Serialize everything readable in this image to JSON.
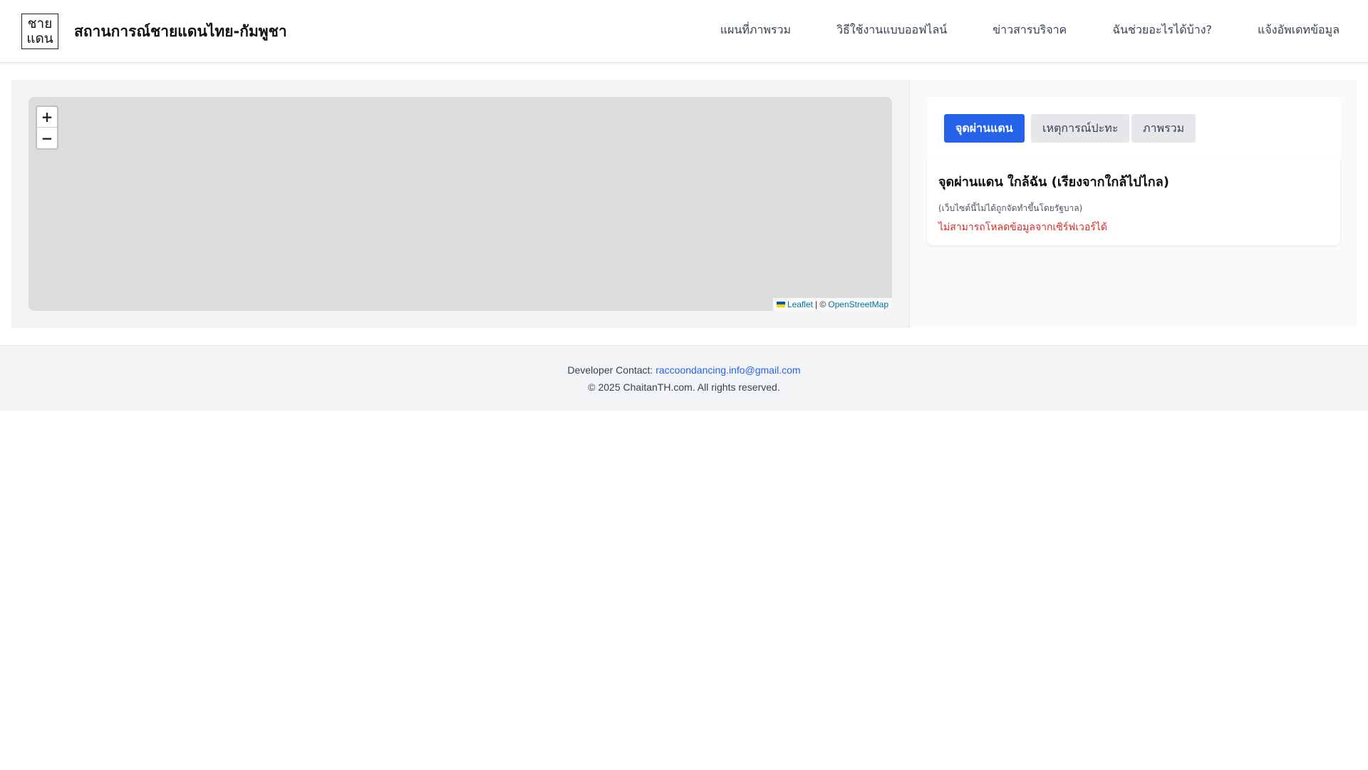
{
  "header": {
    "logo_line1": "ชาย",
    "logo_line2": "แดน",
    "title": "สถานการณ์ชายแดนไทย-กัมพูชา",
    "nav": [
      "แผนที่ภาพรวม",
      "วิธีใช้งานแบบออฟไลน์",
      "ข่าวสารบริจาค",
      "ฉันช่วยอะไรได้บ้าง?",
      "แจ้งอัพเดทข้อมูล"
    ]
  },
  "map": {
    "zoom_in": "+",
    "zoom_out": "−",
    "attribution_leaflet": "Leaflet",
    "attribution_sep": "| ©",
    "attribution_osm": "OpenStreetMap"
  },
  "panel": {
    "tabs": [
      "จุดผ่านแดน",
      "เหตุการณ์ปะทะ",
      "ภาพรวม"
    ],
    "active_tab": 0,
    "title": "จุดผ่านแดน ใกล้ฉัน (เรียงจากใกล้ไปไกล)",
    "note": "(เว็บไซต์นี้ไม่ได้ถูกจัดทำขึ้นโดยรัฐบาล)",
    "error": "ไม่สามารถโหลดข้อมูลจากเซิร์ฟเวอร์ได้"
  },
  "footer": {
    "contact_label": "Developer Contact:",
    "contact_email": "raccoondancing.info@gmail.com",
    "copyright": "© 2025 ChaitanTH.com. All rights reserved."
  },
  "colors": {
    "accent": "#2563eb",
    "error": "#dc2626"
  }
}
